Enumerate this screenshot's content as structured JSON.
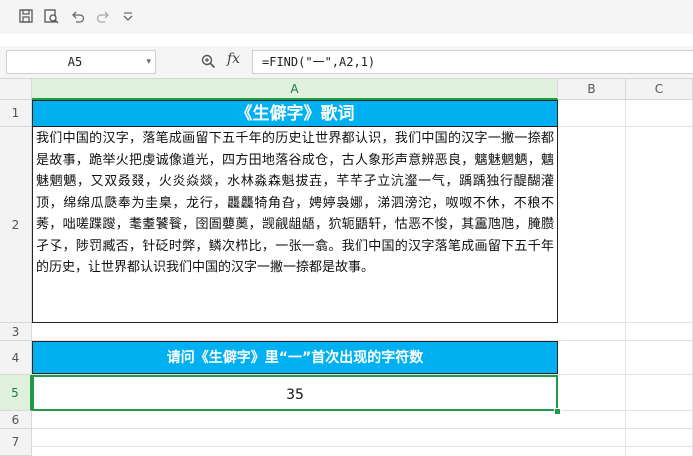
{
  "toolbar": {
    "icons": [
      "save-icon",
      "print-preview-icon",
      "undo-icon",
      "redo-icon",
      "customize-dropdown-icon"
    ]
  },
  "formula_bar": {
    "name_box": "A5",
    "fx_label": "fx",
    "formula": "=FIND(\"一\",A2,1)"
  },
  "columns": [
    "A",
    "B",
    "C"
  ],
  "rows": [
    "1",
    "2",
    "3",
    "4",
    "5",
    "6",
    "7"
  ],
  "cells": {
    "A1": "《生僻字》歌词",
    "A2": "我们中国的汉字，落笔成画留下五千年的历史让世界都认识，我们中国的汉字一撇一捺都是故事，跪举火把虔诚像道光，四方田地落谷成仓，古人象形声意辨恶良，魑魅魍魉，魑魅魍魉，又双叒叕，火炎焱燚，水林淼森魁拔壵，芊芊孑立沆瀣一气，踽踽独行醍醐灌顶，绵绵瓜瓞奉为圭臬，龙行，龘龘犄角旮，娉婷袅娜，涕泗滂沱，呶呶不休，不稂不莠，咄嗟蹀躞，耄耋饕餮，囹圄蘡薁，觊觎龃龉，狖轭鼯轩，怙恶不悛，其靁虺虺，腌臜孑孓，陟罚臧否，针砭时弊，鳞次栉比，一张一翕。我们中国的汉字落笔成画留下五千年的历史，让世界都认识我们中国的汉字一撇一捺都是故事。",
    "A4": "请问《生僻字》里“一”首次出现的字符数",
    "A5": "35"
  },
  "colors": {
    "header_fill": "#00b0f0",
    "selection": "#1f9b46",
    "toolbar_bg": "#f5f5f5"
  }
}
